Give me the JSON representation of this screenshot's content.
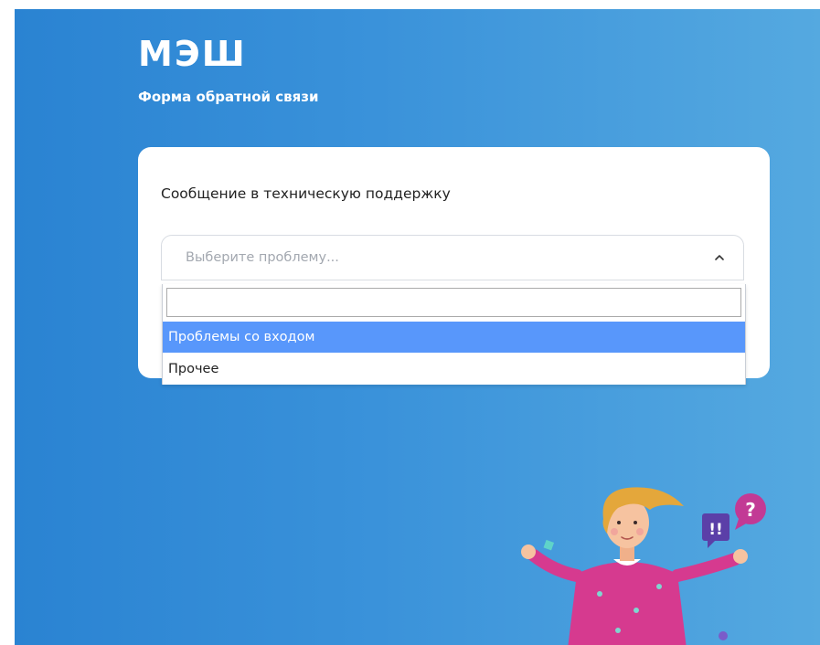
{
  "header": {
    "logo_text": "МЭШ",
    "subtitle": "Форма обратной связи"
  },
  "card": {
    "title": "Сообщение в техническую поддержку",
    "select": {
      "placeholder": "Выберите проблему...",
      "expanded": true,
      "chevron_icon": "chevron-up-icon"
    },
    "dropdown": {
      "search_value": "",
      "options": [
        {
          "label": "Проблемы со входом",
          "highlighted": true
        },
        {
          "label": "Прочее",
          "highlighted": false
        }
      ]
    }
  },
  "illustration": {
    "icons": [
      "woman-shrugging-illustration",
      "exclamation-speech-bubble-icon",
      "question-speech-bubble-icon"
    ],
    "bubble_marks": [
      "!!",
      "?"
    ]
  },
  "colors": {
    "background_gradient_start": "#2a83d2",
    "background_gradient_end": "#55a9e0",
    "option_highlight": "#5897fb",
    "placeholder_text": "#a3a8b0",
    "card_background": "#ffffff"
  }
}
